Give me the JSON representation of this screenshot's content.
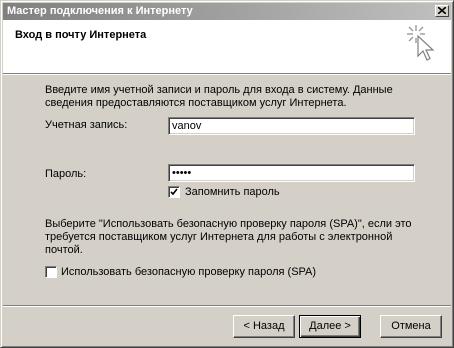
{
  "window": {
    "title": "Мастер подключения к Интернету"
  },
  "header": {
    "title": "Вход в почту Интернета",
    "icon": "wizard-sparkle-cursor-icon"
  },
  "body": {
    "intro": "Введите имя учетной записи и пароль для входа в систему. Данные сведения предоставляются поставщиком услуг Интернета.",
    "account_label": "Учетная запись:",
    "account_value": "vanov",
    "password_label": "Пароль:",
    "password_value": "•••••",
    "remember_label": "Запомнить пароль",
    "remember_checked": true,
    "spa_info": "Выберите \"Использовать безопасную проверку пароля (SPA)\", если это требуется поставщиком услуг Интернета для работы с электронной почтой.",
    "spa_label": "Использовать безопасную проверку пароля (SPA)",
    "spa_checked": false
  },
  "buttons": {
    "back": "< Назад",
    "next": "Далее >",
    "cancel": "Отмена"
  },
  "colors": {
    "face": "#d4d0c8",
    "titlebar_start": "#808080",
    "titlebar_end": "#c0c0c0"
  }
}
